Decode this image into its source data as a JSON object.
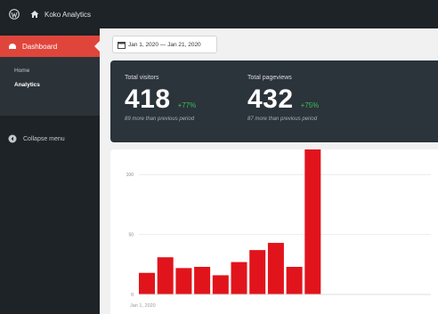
{
  "adminbar": {
    "site_name": "Koko Analytics",
    "icons": [
      "wordpress-logo-icon",
      "home-icon"
    ]
  },
  "sidebar": {
    "active_item": {
      "label": "Dashboard",
      "icon": "dashboard-icon"
    },
    "submenu": [
      {
        "label": "Home",
        "active": false
      },
      {
        "label": "Analytics",
        "active": true
      }
    ],
    "collapse_label": "Collapse menu"
  },
  "date_range": {
    "label": "Jan 1, 2020 — Jan 21, 2020",
    "icon": "calendar-icon"
  },
  "stats": {
    "visitors": {
      "label": "Total visitors",
      "value": "418",
      "change": "+77%",
      "subtext": "89 more than previous period"
    },
    "pageviews": {
      "label": "Total pageviews",
      "value": "432",
      "change": "+75%",
      "subtext": "87 more than previous period"
    }
  },
  "colors": {
    "accent": "#e0453b",
    "bar": "#e1141c",
    "bar_top": "#f06f6f",
    "positive": "#3fbf57",
    "dark_panel": "#2b333b"
  },
  "chart_data": {
    "type": "bar",
    "x_start_label": "Jan 1, 2020",
    "yticks": [
      "0",
      "50",
      "100"
    ],
    "ylim": [
      0,
      115
    ],
    "grid": true,
    "series": [
      {
        "values": [
          18,
          31,
          22,
          23,
          16,
          27,
          37,
          43,
          23,
          121
        ]
      },
      {
        "values": [
          0,
          0,
          0,
          0,
          0,
          0,
          0,
          0,
          0,
          6
        ]
      }
    ]
  }
}
